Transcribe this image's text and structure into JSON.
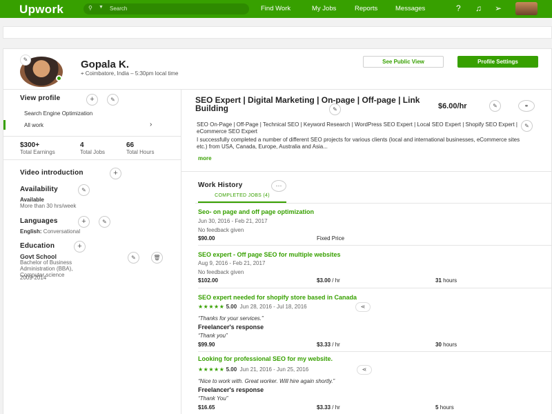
{
  "nav": {
    "logo": "Upwork",
    "search_placeholder": "Search",
    "links": [
      "Find Work",
      "My Jobs",
      "Reports",
      "Messages"
    ],
    "icons": [
      "help-icon",
      "bell-icon",
      "send-icon",
      "avatar"
    ]
  },
  "profile": {
    "name": "Gopala K.",
    "location": "Coimbatore, India – 5:30pm local time",
    "see_public_view": "See Public View",
    "profile_settings": "Profile Settings"
  },
  "sidebar": {
    "view_profile": "View profile",
    "specialized": "Search Engine Optimization",
    "all_work": "All work",
    "stats": [
      {
        "value": "$300+",
        "label": "Total Earnings"
      },
      {
        "value": "4",
        "label": "Total Jobs"
      },
      {
        "value": "66",
        "label": "Total Hours"
      }
    ],
    "video_intro": "Video introduction",
    "availability": "Availability",
    "availability_status": "Available",
    "availability_hours": "More than 30 hrs/week",
    "languages": "Languages",
    "language_name": "English:",
    "language_level": "Conversational",
    "education": "Education",
    "edu_school": "Govt School",
    "edu_degree": "Bachelor of Business Administration (BBA), Computer science",
    "edu_years": "2009-2014"
  },
  "main": {
    "title": "SEO Expert | Digital Marketing | On-page | Off-page | Link Building",
    "rate": "$6.00/hr",
    "skills": "SEO On-Page | Off-Page | Technical SEO | Keyword Research | WordPress SEO Expert | Local SEO Expert | Shopify SEO Expert | eCommerce SEO Expert",
    "description": "I successfully completed a number of different SEO projects for various clients (local and international businesses, eCommerce sites etc.) from USA, Canada, Europe, Australia and Asia...",
    "more": "more",
    "work_history": "Work History",
    "tab": "COMPLETED JOBS (4)",
    "jobs": [
      {
        "title": "Seo- on page and off page optimization",
        "dates": "Jun 30, 2016 - Feb 21, 2017",
        "feedback": "No feedback given",
        "amount": "$90.00",
        "type": "Fixed Price"
      },
      {
        "title": "SEO expert - Off page SEO for multiple websites",
        "dates": "Aug 9, 2016 - Feb 21, 2017",
        "feedback": "No feedback given",
        "amount": "$102.00",
        "rate": "$3.00",
        "rate_unit": "/ hr",
        "hours": "31",
        "hours_unit": "hours"
      },
      {
        "title": "SEO expert needed for shopify store based in Canada",
        "stars": "★★★★★",
        "score": "5.00",
        "dates": "Jun 28, 2016 - Jul 18, 2016",
        "comment": "“Thanks for your services.”",
        "response_label": "Freelancer's response",
        "response": "“Thank you”",
        "amount": "$99.90",
        "rate": "$3.33",
        "rate_unit": "/ hr",
        "hours": "30",
        "hours_unit": "hours"
      },
      {
        "title": "Looking for professional SEO for my website.",
        "stars": "★★★★★",
        "score": "5.00",
        "dates": "Jun 21, 2016 - Jun 25, 2016",
        "comment": "“Nice to work with. Great worker. Will hire again shortly.”",
        "response_label": "Freelancer's response",
        "response": "“Thank You”",
        "amount": "$16.65",
        "rate": "$3.33",
        "rate_unit": "/ hr",
        "hours": "5",
        "hours_unit": "hours"
      }
    ]
  },
  "colors": {
    "brand": "#37a000"
  }
}
